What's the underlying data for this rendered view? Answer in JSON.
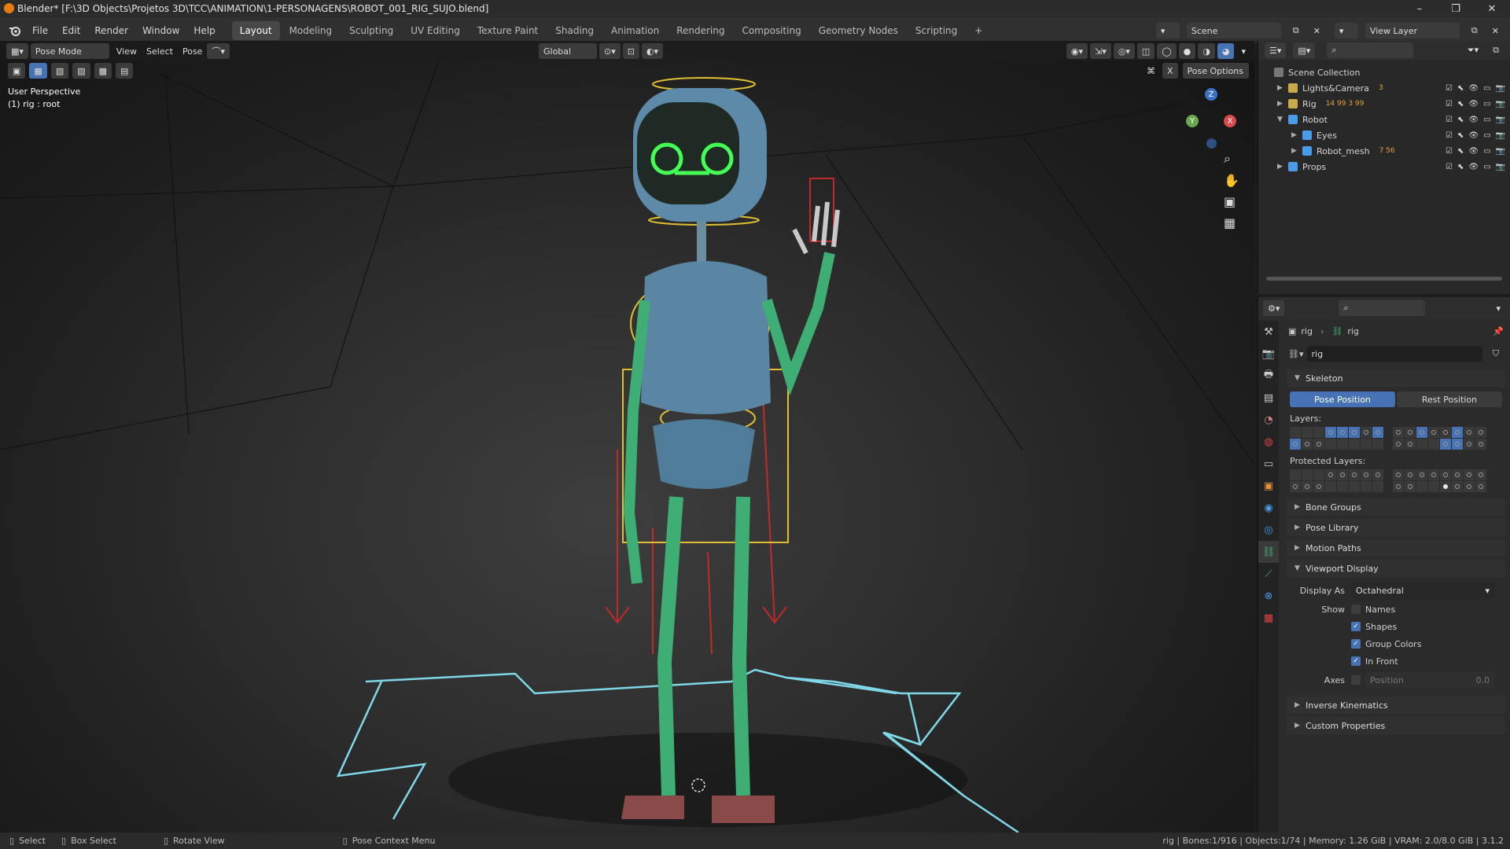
{
  "title_bar": {
    "title": "Blender* [F:\\3D Objects\\Projetos 3D\\TCC\\ANIMATION\\1-PERSONAGENS\\ROBOT_001_RIG_SUJO.blend]",
    "minimize": "–",
    "maximize": "❐",
    "close": "✕"
  },
  "menu": {
    "items": [
      "File",
      "Edit",
      "Render",
      "Window",
      "Help"
    ],
    "workspaces": [
      "Layout",
      "Modeling",
      "Sculpting",
      "UV Editing",
      "Texture Paint",
      "Shading",
      "Animation",
      "Rendering",
      "Compositing",
      "Geometry Nodes",
      "Scripting"
    ],
    "add_tab": "+",
    "scene_label": "Scene",
    "view_layer_label": "View Layer"
  },
  "viewport_header": {
    "mode": "Pose Mode",
    "menus": [
      "View",
      "Select",
      "Pose"
    ],
    "transform_orientation": "Global",
    "pose_options": "Pose Options"
  },
  "viewport": {
    "perspective": "User Perspective",
    "active_info": "(1) rig : root",
    "gizmo_axes": [
      "Z",
      "Y",
      "X"
    ]
  },
  "outliner": {
    "root": "Scene Collection",
    "rows": [
      {
        "name": "Lights&Camera",
        "depth": 1,
        "expanded": false,
        "badges": "3"
      },
      {
        "name": "Rig",
        "depth": 1,
        "expanded": false,
        "badges": "14  99  3  99"
      },
      {
        "name": "Robot",
        "depth": 1,
        "expanded": true,
        "badges": ""
      },
      {
        "name": "Eyes",
        "depth": 2,
        "expanded": false,
        "badges": ""
      },
      {
        "name": "Robot_mesh",
        "depth": 2,
        "expanded": false,
        "badges": "7  56"
      },
      {
        "name": "Props",
        "depth": 1,
        "expanded": false,
        "badges": ""
      }
    ]
  },
  "properties": {
    "breadcrumb": [
      "rig",
      "rig"
    ],
    "data_name": "rig",
    "skeleton": {
      "header": "Skeleton",
      "pose_position": "Pose Position",
      "rest_position": "Rest Position",
      "layers_label": "Layers:",
      "protected_layers_label": "Protected Layers:"
    },
    "collapsed_panels_a": [
      "Bone Groups",
      "Pose Library",
      "Motion Paths"
    ],
    "viewport_display": {
      "header": "Viewport Display",
      "display_as_label": "Display As",
      "display_as_value": "Octahedral",
      "show_label": "Show",
      "checkboxes": [
        {
          "label": "Names",
          "checked": false
        },
        {
          "label": "Shapes",
          "checked": true
        },
        {
          "label": "Group Colors",
          "checked": true
        },
        {
          "label": "In Front",
          "checked": true
        }
      ],
      "axes_label": "Axes",
      "axes_position_label": "Position",
      "axes_position_value": "0.0"
    },
    "collapsed_panels_b": [
      "Inverse Kinematics",
      "Custom Properties"
    ]
  },
  "status_bar": {
    "select": "Select",
    "box_select": "Box Select",
    "rotate_view": "Rotate View",
    "pose_context_menu": "Pose Context Menu",
    "stats": "rig | Bones:1/916 | Objects:1/74 | Memory: 1.26 GiB | VRAM: 2.0/8.0 GiB | 3.1.2"
  },
  "colors": {
    "accent": "#4772b3",
    "bone_green": "#3fae74",
    "widget_yellow": "#e0c030",
    "widget_red": "#c22a2a",
    "widget_cyan": "#7fd8e8",
    "eye_glow": "#44ff55"
  }
}
